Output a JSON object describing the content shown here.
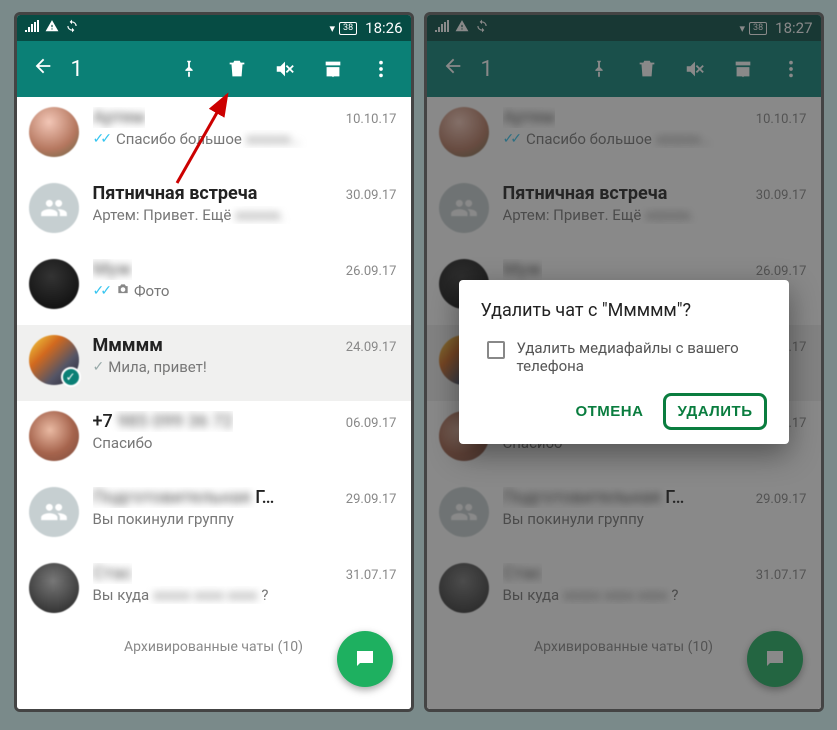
{
  "status": {
    "time_left": "18:26",
    "time_right": "18:27",
    "battery": "38"
  },
  "toolbar": {
    "selected_count": "1"
  },
  "chats": [
    {
      "name": "Артем",
      "name_blurred": true,
      "date": "10.10.17",
      "preview_prefix": "✓✓",
      "preview": "Спасибо большое",
      "preview_blur_tail": "xxxxxx…",
      "avatar": "av-img1",
      "bold": false
    },
    {
      "name": "Пятничная встреча",
      "date": "30.09.17",
      "preview": "Артем: Привет. Ещё ",
      "preview_blur_tail": "xxxxxx.",
      "avatar": "group",
      "bold": true
    },
    {
      "name": "Муж",
      "name_blurred": true,
      "date": "26.09.17",
      "preview_prefix": "✓✓",
      "preview_icon": "camera",
      "preview": "Фото",
      "avatar": "av-img2",
      "bold": false
    },
    {
      "name": "Ммммм",
      "date": "24.09.17",
      "preview_prefix": "✓",
      "preview": "Мила, привет!",
      "avatar": "av-img3",
      "bold": true,
      "selected": true
    },
    {
      "name": "+7 ",
      "name_blur_tail": "985 099 36 72",
      "date": "06.09.17",
      "preview": "Спасибо",
      "avatar": "av-img4",
      "bold": false
    },
    {
      "name": "Подготовительная Г…",
      "name_blurred_part": true,
      "date": "29.09.17",
      "preview": "Вы покинули группу",
      "avatar": "group",
      "bold": false
    },
    {
      "name": "Стас",
      "name_blurred": true,
      "date": "31.07.17",
      "preview": "Вы куда ",
      "preview_blur_tail": "xxxxx xxxx xxxx",
      "preview_tail": "?",
      "avatar": "av-img5",
      "bold": false
    }
  ],
  "archived_label": "Архивированные чаты (10)",
  "dialog": {
    "title": "Удалить чат с \"Ммммм\"?",
    "checkbox_label": "Удалить медиафайлы с вашего телефона",
    "cancel": "ОТМЕНА",
    "confirm": "УДАЛИТЬ"
  }
}
